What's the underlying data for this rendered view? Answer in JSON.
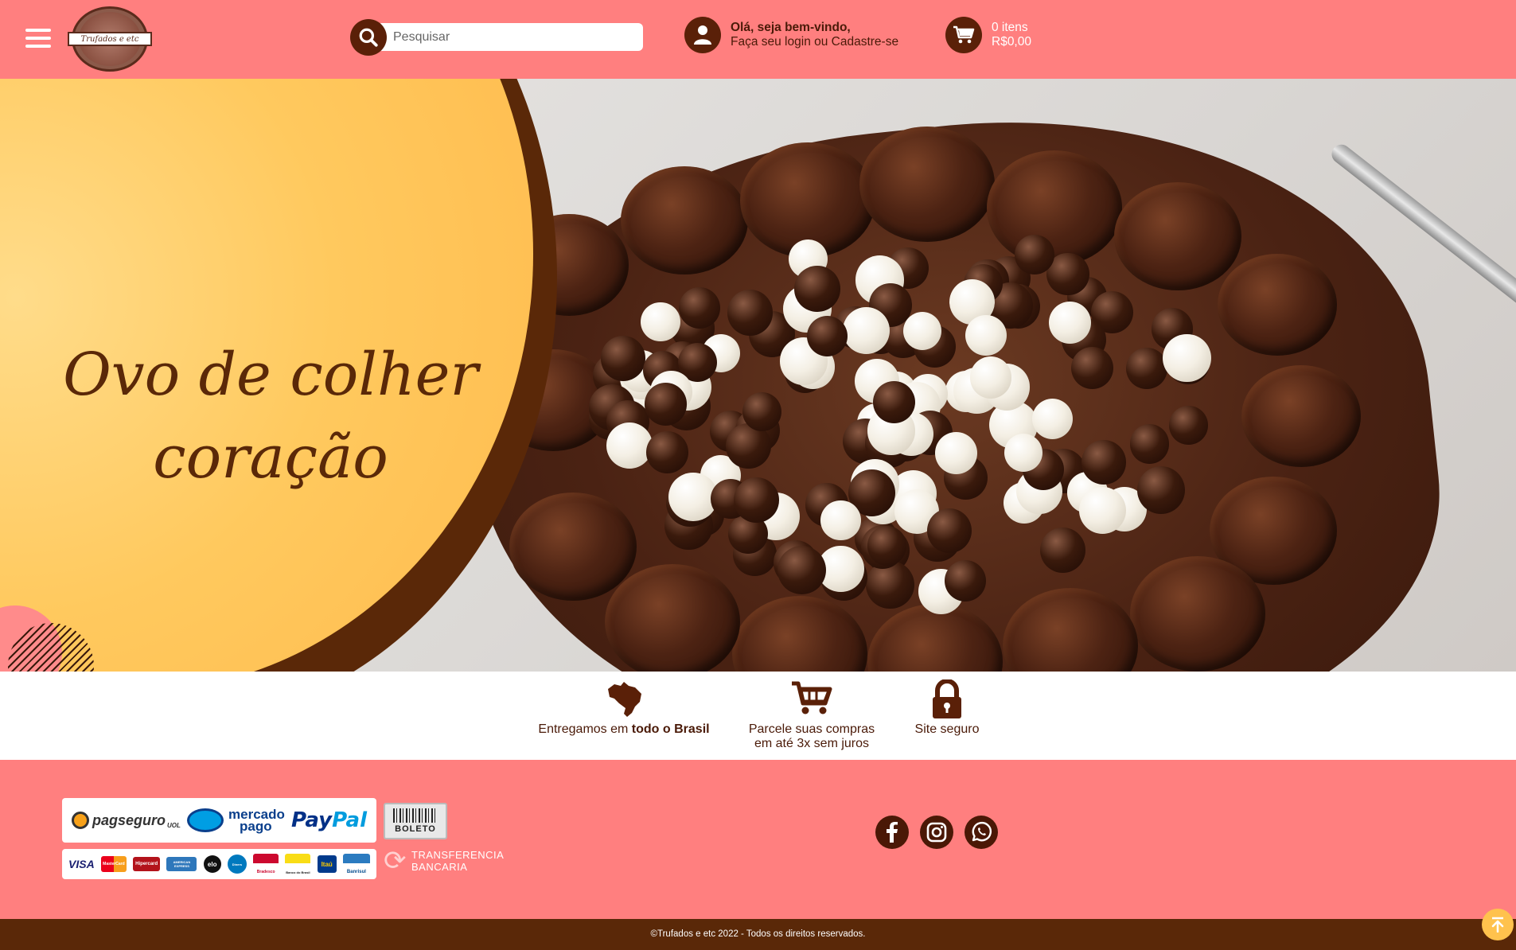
{
  "header": {
    "menu_icon": "hamburger-menu-icon",
    "logo_text": "Trufados e etc",
    "search": {
      "placeholder": "Pesquisar",
      "icon": "search-icon"
    },
    "user": {
      "greeting": "Olá, seja bem-vindo,",
      "subtext": "Faça seu login ou Cadastre-se",
      "icon": "user-icon"
    },
    "cart": {
      "items": "0 itens",
      "total": "R$0,00",
      "icon": "cart-icon"
    }
  },
  "hero": {
    "title_line1": "Ovo de colher",
    "title_line2": "coração"
  },
  "benefits": [
    {
      "icon": "brazil-map-icon",
      "text_prefix": "Entregamos em ",
      "text_bold": "todo o Brasil"
    },
    {
      "icon": "shopping-cart-icon",
      "line1": "Parcele suas compras",
      "line2": "em até 3x sem juros"
    },
    {
      "icon": "padlock-icon",
      "line1": "Site seguro"
    }
  ],
  "payments": {
    "pagseguro": "pagseguro",
    "pagseguro_sub": "UOL",
    "mercado_line1": "mercado",
    "mercado_line2": "pago",
    "paypal_a": "Pay",
    "paypal_b": "Pal",
    "cards": [
      "VISA",
      "MasterCard",
      "Hipercard",
      "AMERICAN EXPRESS",
      "elo",
      "Diners",
      "Bradesco",
      "Banco do Brasil",
      "Itaú",
      "Banrisul"
    ],
    "boleto": "BOLETO",
    "transfer_line1": "TRANSFERENCIA",
    "transfer_line2": "BANCARIA"
  },
  "social": [
    "facebook-icon",
    "instagram-icon",
    "whatsapp-icon"
  ],
  "footer": {
    "copyright": "©Trufados e etc 2022 - Todos os direitos reservados."
  },
  "colors": {
    "header_bg": "#ff7f7f",
    "brown": "#5a2808",
    "yellow": "#ffc95e"
  }
}
